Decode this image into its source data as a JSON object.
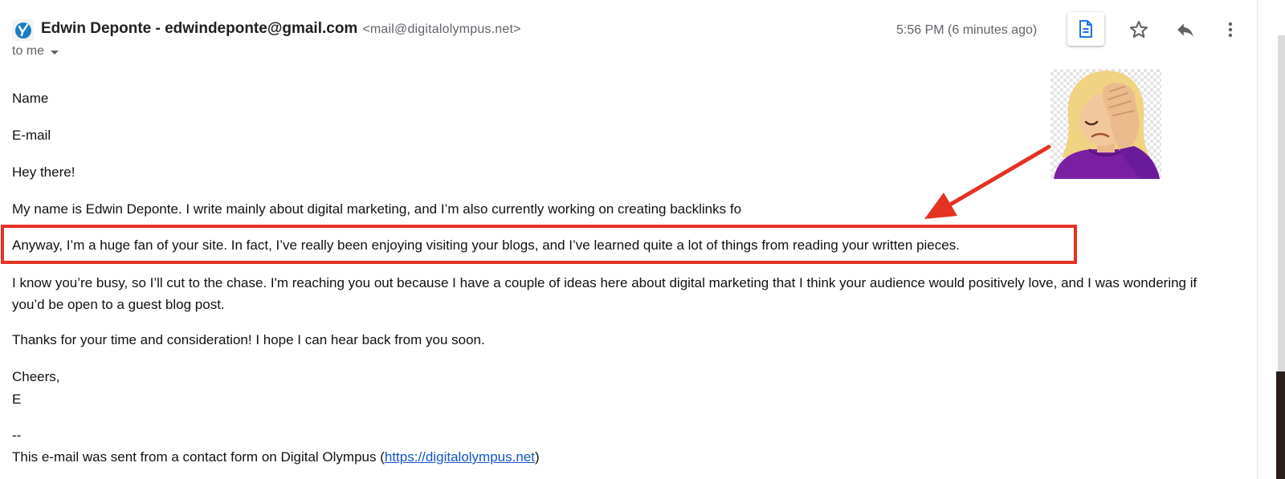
{
  "header": {
    "sender_name": "Edwin Deponte - edwindeponte@gmail.com",
    "sender_address": "<mail@digitalolympus.net>",
    "recipient": "to me",
    "timestamp": "5:56 PM (6 minutes ago)",
    "icons": [
      "yoast-logo-icon",
      "document-icon",
      "star-icon",
      "reply-icon",
      "more-vert-icon"
    ]
  },
  "body": {
    "name_label": "Name",
    "email_label": "E-mail",
    "greeting": "Hey there!",
    "intro": "My name is Edwin Deponte. I write mainly about digital marketing, and I’m also currently working on creating backlinks fo",
    "highlighted": "Anyway, I’m a huge fan of your site. In fact, I’ve really been enjoying visiting your blogs, and I’ve learned quite a lot of things from reading your written pieces.",
    "pitch": "I know you’re busy, so I’ll cut to the chase. I'm reaching you out because I have a couple of ideas here about digital marketing that I think your audience would positively love, and I was wondering if you’d be open to a guest blog post.",
    "thanks": "Thanks for your time and consideration! I hope I can hear back from you soon.",
    "signoff": "Cheers,",
    "signature_initial": "E",
    "separator": "--",
    "footer_prefix": "This e-mail was sent from a contact form on Digital Olympus (",
    "footer_link": "https://digitalolympus.net",
    "footer_suffix": ")"
  },
  "annotation": {
    "emoji": "woman-facepalming-emoji",
    "highlight_color": "#e53223"
  }
}
